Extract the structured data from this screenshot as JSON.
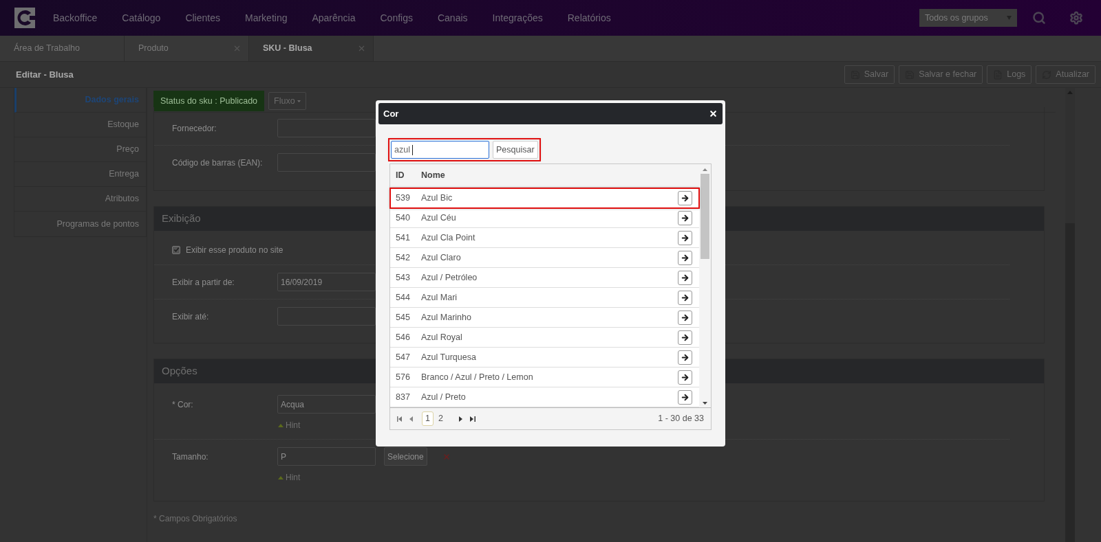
{
  "nav": {
    "items": [
      "Backoffice",
      "Catálogo",
      "Clientes",
      "Marketing",
      "Aparência",
      "Configs",
      "Canais",
      "Integrações",
      "Relatórios"
    ],
    "group_select": "Todos os grupos"
  },
  "tabs": [
    {
      "label": "Área de Trabalho",
      "selected": false,
      "closable": false
    },
    {
      "label": "Produto",
      "selected": false,
      "closable": true
    },
    {
      "label": "SKU - Blusa",
      "selected": true,
      "closable": true
    }
  ],
  "page_title": "Editar - Blusa",
  "toolbar": [
    {
      "label": "Salvar",
      "kind": "save"
    },
    {
      "label": "Salvar e fechar",
      "kind": "save"
    },
    {
      "label": "Logs",
      "kind": "doc"
    },
    {
      "label": "Atualizar",
      "kind": "refresh"
    }
  ],
  "sidebar": [
    {
      "label": "Dados gerais",
      "selected": true
    },
    {
      "label": "Estoque",
      "selected": false
    },
    {
      "label": "Preço",
      "selected": false
    },
    {
      "label": "Entrega",
      "selected": false
    },
    {
      "label": "Atributos",
      "selected": false
    },
    {
      "label": "Programas de pontos",
      "selected": false
    }
  ],
  "status_badge": "Status do sku : Publicado",
  "flow_button": "Fluxo",
  "sections": [
    {
      "fields": [
        {
          "kind": "input",
          "label": "Fornecedor:"
        },
        {
          "kind": "input",
          "label": "Código de barras (EAN):"
        }
      ]
    },
    {
      "title": "Exibição",
      "fields": [
        {
          "kind": "checkbox",
          "label": "Exibir esse produto no site",
          "checked": true
        },
        {
          "kind": "input",
          "label": "Exibir a partir de:",
          "value": "16/09/2019"
        },
        {
          "kind": "input",
          "label": "Exibir até:"
        }
      ]
    },
    {
      "title": "Opções",
      "fields": [
        {
          "kind": "input",
          "label": "* Cor:",
          "value": "Acqua",
          "hint": "Hint"
        },
        {
          "kind": "input",
          "label": "Tamanho:",
          "value": "P",
          "hint": "Hint",
          "button": "Selecione"
        }
      ]
    }
  ],
  "required_note": "* Campos Obrigatórios",
  "modal": {
    "title": "Cor",
    "search": {
      "value": "azul",
      "highlighted": true
    },
    "search_button": "Pesquisar",
    "columns": [
      "ID",
      "Nome"
    ],
    "rows": [
      {
        "id": "539",
        "name": "Azul Bic",
        "selected": true
      },
      {
        "id": "540",
        "name": "Azul Céu",
        "selected": false
      },
      {
        "id": "541",
        "name": "Azul Cla Point",
        "selected": false
      },
      {
        "id": "542",
        "name": "Azul Claro",
        "selected": false
      },
      {
        "id": "543",
        "name": "Azul / Petróleo",
        "selected": false
      },
      {
        "id": "544",
        "name": "Azul Mari",
        "selected": false
      },
      {
        "id": "545",
        "name": "Azul Marinho",
        "selected": false
      },
      {
        "id": "546",
        "name": "Azul Royal",
        "selected": false
      },
      {
        "id": "547",
        "name": "Azul Turquesa",
        "selected": false
      },
      {
        "id": "576",
        "name": "Branco / Azul / Preto / Lemon",
        "selected": false
      },
      {
        "id": "837",
        "name": "Azul / Preto",
        "selected": false
      }
    ],
    "pages": [
      {
        "label": "1",
        "selected": true
      },
      {
        "label": "2",
        "selected": false
      }
    ],
    "summary": "1 - 30 de 33"
  }
}
